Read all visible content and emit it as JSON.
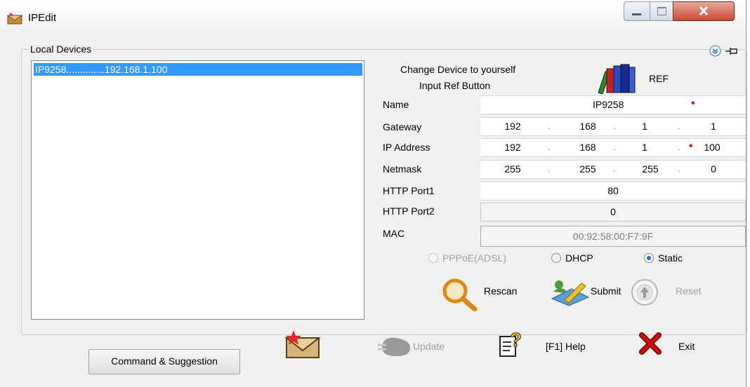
{
  "window": {
    "title": "IPEdit"
  },
  "local_devices": {
    "label": "Local Devices",
    "items": [
      {
        "text": "IP9258..............192.168.1.100"
      }
    ]
  },
  "ref": {
    "line1": "Change Device to yourself",
    "line2": "Input Ref Button",
    "button_label": "REF"
  },
  "form": {
    "name": {
      "label": "Name",
      "value": "IP9258"
    },
    "gateway": {
      "label": "Gateway",
      "octets": [
        "192",
        "168",
        "1",
        "1"
      ]
    },
    "ip_address": {
      "label": "IP Address",
      "octets": [
        "192",
        "168",
        "1",
        "100"
      ]
    },
    "netmask": {
      "label": "Netmask",
      "octets": [
        "255",
        "255",
        "255",
        "0"
      ]
    },
    "http_port1": {
      "label": "HTTP Port1",
      "value": "80"
    },
    "http_port2": {
      "label": "HTTP Port2",
      "value": "0"
    },
    "mac": {
      "label": "MAC",
      "value": "00:92:58:00:F7:9F"
    }
  },
  "mode": {
    "options": [
      "PPPoE(ADSL)",
      "DHCP",
      "Static"
    ],
    "selected": "Static"
  },
  "actions": {
    "rescan": "Rescan",
    "submit": "Submit",
    "reset": "Reset"
  },
  "toolbar": {
    "update": "Update",
    "help": "[F1] Help",
    "exit": "Exit",
    "command": "Command & Suggestion"
  },
  "colors": {
    "selection": "#3399ff",
    "required_marker": "#e01010",
    "close_button": "#c74a34"
  }
}
